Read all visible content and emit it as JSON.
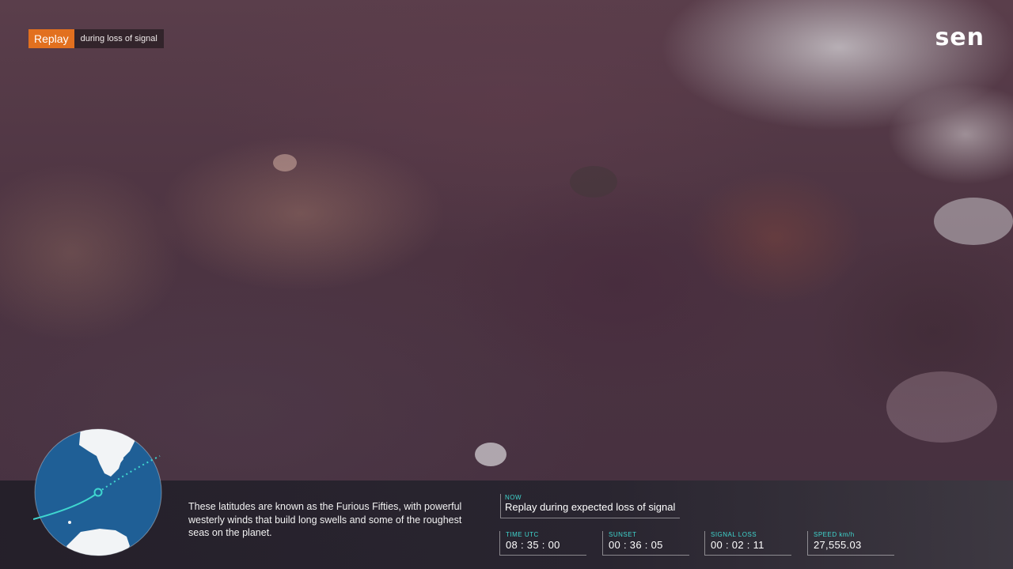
{
  "replay": {
    "label": "Replay",
    "note": "during loss of signal"
  },
  "logo": {
    "text": "sen"
  },
  "caption": "These latitudes are known as the Furious Fifties, with powerful westerly winds that build long swells and some of the roughest seas on the planet.",
  "now": {
    "label": "NOW",
    "text": "Replay during expected loss of signal"
  },
  "stats": [
    {
      "label": "TIME UTC",
      "value": "08 : 35 : 00"
    },
    {
      "label": "SUNSET",
      "value": "00 : 36 : 05"
    },
    {
      "label": "SIGNAL LOSS",
      "value": "00 : 02 : 11"
    },
    {
      "label": "SPEED km/h",
      "value": "27,555.03"
    }
  ],
  "colors": {
    "accent_orange": "#e2701f",
    "accent_teal": "#3fd6cf",
    "ocean": "#1f5f96",
    "land": "#f2f4f6"
  },
  "globe": {
    "icon": "globe-orbit-icon"
  }
}
